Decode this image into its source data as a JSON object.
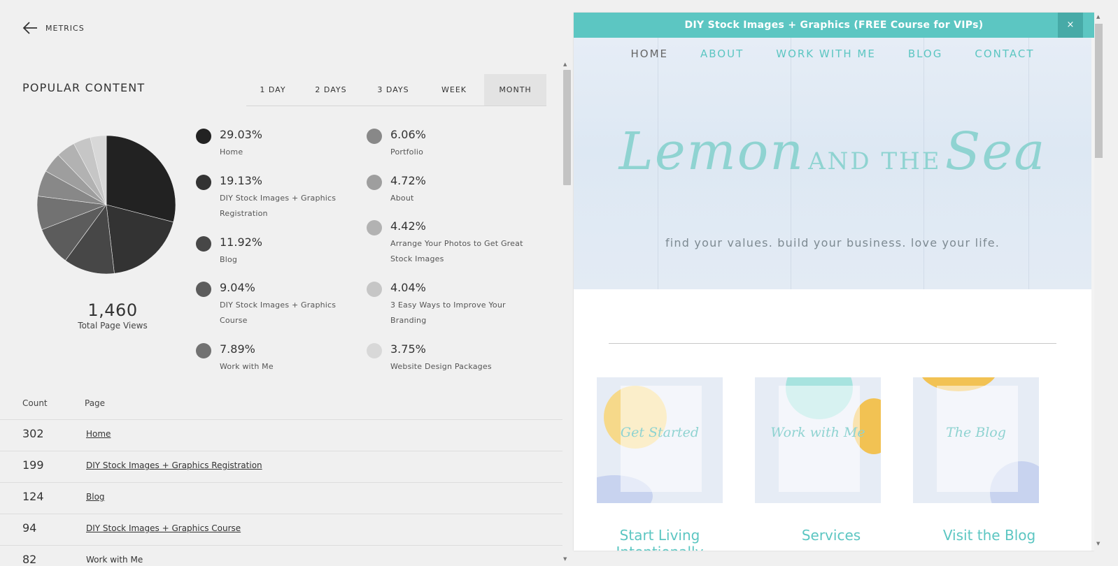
{
  "header": {
    "back_label": "METRICS"
  },
  "popular": {
    "title": "POPULAR CONTENT",
    "tabs": [
      "1 DAY",
      "2 DAYS",
      "3 DAYS",
      "WEEK",
      "MONTH"
    ],
    "active_tab": "MONTH",
    "total_value": "1,460",
    "total_label": "Total Page Views"
  },
  "chart_data": {
    "type": "pie",
    "slices": [
      {
        "label": "Home",
        "percent": 29.03,
        "color": "#222222"
      },
      {
        "label": "DIY Stock Images + Graphics Registration",
        "percent": 19.13,
        "color": "#333333"
      },
      {
        "label": "Blog",
        "percent": 11.92,
        "color": "#474747"
      },
      {
        "label": "DIY Stock Images + Graphics Course",
        "percent": 9.04,
        "color": "#5c5c5c"
      },
      {
        "label": "Work with Me",
        "percent": 7.89,
        "color": "#727272"
      },
      {
        "label": "Portfolio",
        "percent": 6.06,
        "color": "#888888"
      },
      {
        "label": "About",
        "percent": 4.72,
        "color": "#9e9e9e"
      },
      {
        "label": "Arrange Your Photos to Get Great Stock Images",
        "percent": 4.42,
        "color": "#b2b2b2"
      },
      {
        "label": "3 Easy Ways to Improve Your Branding",
        "percent": 4.04,
        "color": "#c6c6c6"
      },
      {
        "label": "Website Design Packages",
        "percent": 3.75,
        "color": "#d8d8d8"
      }
    ],
    "legend": [
      {
        "pct": "29.03%",
        "label": "Home"
      },
      {
        "pct": "19.13%",
        "label": "DIY Stock Images + Graphics Registration"
      },
      {
        "pct": "11.92%",
        "label": "Blog"
      },
      {
        "pct": "9.04%",
        "label": "DIY Stock Images + Graphics Course"
      },
      {
        "pct": "7.89%",
        "label": "Work with Me"
      },
      {
        "pct": "6.06%",
        "label": "Portfolio"
      },
      {
        "pct": "4.72%",
        "label": "About"
      },
      {
        "pct": "4.42%",
        "label": "Arrange Your Photos to Get Great Stock Images"
      },
      {
        "pct": "4.04%",
        "label": "3 Easy Ways to Improve Your Branding"
      },
      {
        "pct": "3.75%",
        "label": "Website Design Packages"
      }
    ]
  },
  "table": {
    "headers": [
      "Count",
      "Page"
    ],
    "rows": [
      {
        "count": "302",
        "page": "Home"
      },
      {
        "count": "199",
        "page": "DIY Stock Images + Graphics Registration"
      },
      {
        "count": "124",
        "page": "Blog"
      },
      {
        "count": "94",
        "page": "DIY Stock Images + Graphics Course"
      },
      {
        "count": "82",
        "page": "Work with Me"
      }
    ]
  },
  "preview": {
    "banner": "DIY Stock Images + Graphics (FREE Course for VIPs)",
    "close": "×",
    "nav": [
      "HOME",
      "ABOUT",
      "WORK WITH ME",
      "BLOG",
      "CONTACT"
    ],
    "logo_part1": "Lemon",
    "logo_part2": "AND THE",
    "logo_part3": "Sea",
    "tagline": "find your values. build your business. love your life.",
    "cards": [
      {
        "script": "Get Started",
        "title": "Start Living Intentionally"
      },
      {
        "script": "Work with Me",
        "title": "Services"
      },
      {
        "script": "The Blog",
        "title": "Visit the Blog"
      }
    ],
    "accent_color": "#5cc6c2"
  }
}
